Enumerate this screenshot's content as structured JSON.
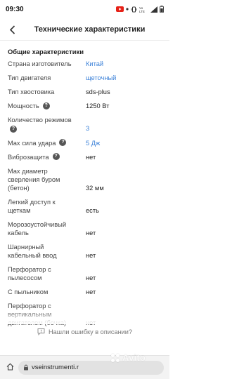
{
  "status": {
    "time": "09:30",
    "icons": [
      "youtube-icon",
      "dot-icon",
      "vibrate-icon",
      "lte-icon",
      "signal-icon",
      "battery-icon"
    ]
  },
  "header": {
    "title": "Технические характеристики",
    "back_icon": "arrow-left-icon"
  },
  "section": {
    "title": "Общие характеристики"
  },
  "specs": [
    {
      "label": "Страна изготовитель",
      "value": "Китай",
      "link": true,
      "help": false
    },
    {
      "label": "Тип двигателя",
      "value": "щеточный",
      "link": true,
      "help": false
    },
    {
      "label": "Тип хвостовика",
      "value": "sds-plus",
      "link": false,
      "help": false
    },
    {
      "label": "Мощность",
      "value": "1250 Вт",
      "link": false,
      "help": true
    },
    {
      "label": "Количество режимов",
      "value": "3",
      "link": true,
      "help": true
    },
    {
      "label": "Max сила удара",
      "value": "5 Дж",
      "link": true,
      "help": true
    },
    {
      "label": "Виброзащита",
      "value": "нет",
      "link": false,
      "help": true
    },
    {
      "label": "Max диаметр сверления буром (бетон)",
      "value": "32 мм",
      "link": false,
      "help": false
    },
    {
      "label": "Легкий доступ к щеткам",
      "value": "есть",
      "link": false,
      "help": false
    },
    {
      "label": "Морозоустойчивый кабель",
      "value": "нет",
      "link": false,
      "help": false
    },
    {
      "label": "Шарнирный кабельный ввод",
      "value": "нет",
      "link": false,
      "help": false
    },
    {
      "label": "Перфоратор с пылесосом",
      "value": "нет",
      "link": false,
      "help": false
    },
    {
      "label": "С пыльником",
      "value": "нет",
      "link": false,
      "help": false
    },
    {
      "label": "Перфоратор с вертикальным двигателем (бочка)",
      "value": "нет",
      "link": false,
      "help": false
    }
  ],
  "report": {
    "label": "Нашли ошибку в описании?",
    "icon": "chat-alert-icon"
  },
  "browser": {
    "url": "vseinstrumenti.r",
    "home_icon": "home-icon",
    "lock_icon": "lock-icon"
  },
  "watermark": {
    "text": "Avito"
  },
  "colors": {
    "link": "#3a80d8",
    "help_icon": "#555555"
  }
}
